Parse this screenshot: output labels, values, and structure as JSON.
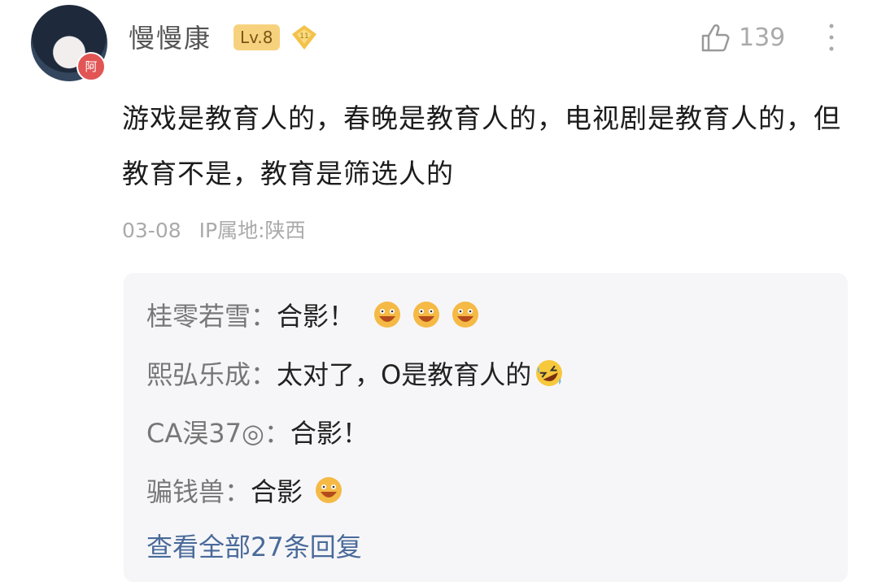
{
  "comment": {
    "user": {
      "name": "慢慢康",
      "level": "Lv.8",
      "avatar_badge": "阿"
    },
    "likes": "139",
    "text": "游戏是教育人的，春晚是教育人的，电视剧是教育人的，但教育不是，教育是筛选人的",
    "date": "03-08",
    "ip_location": "IP属地:陕西"
  },
  "replies": [
    {
      "name": "桂零若雪",
      "sep": "：",
      "text": "合影！",
      "emojis": [
        "laugh-emoji",
        "laugh-emoji",
        "laugh-emoji"
      ]
    },
    {
      "name": "熙弘乐成",
      "sep": "：",
      "text": "太对了，O是教育人的",
      "emojis": [
        "rofl-emoji"
      ]
    },
    {
      "name": "CA淏37◎",
      "sep": "：",
      "text": "合影！",
      "emojis": []
    },
    {
      "name": "骗钱兽",
      "sep": "：",
      "text": "合影",
      "emojis": [
        "laugh-emoji"
      ]
    }
  ],
  "view_all_replies": "查看全部27条回复",
  "colors": {
    "level_badge_bg": "#f7d27e",
    "link": "#4a6a9a",
    "reply_bg": "#f6f6f8"
  }
}
